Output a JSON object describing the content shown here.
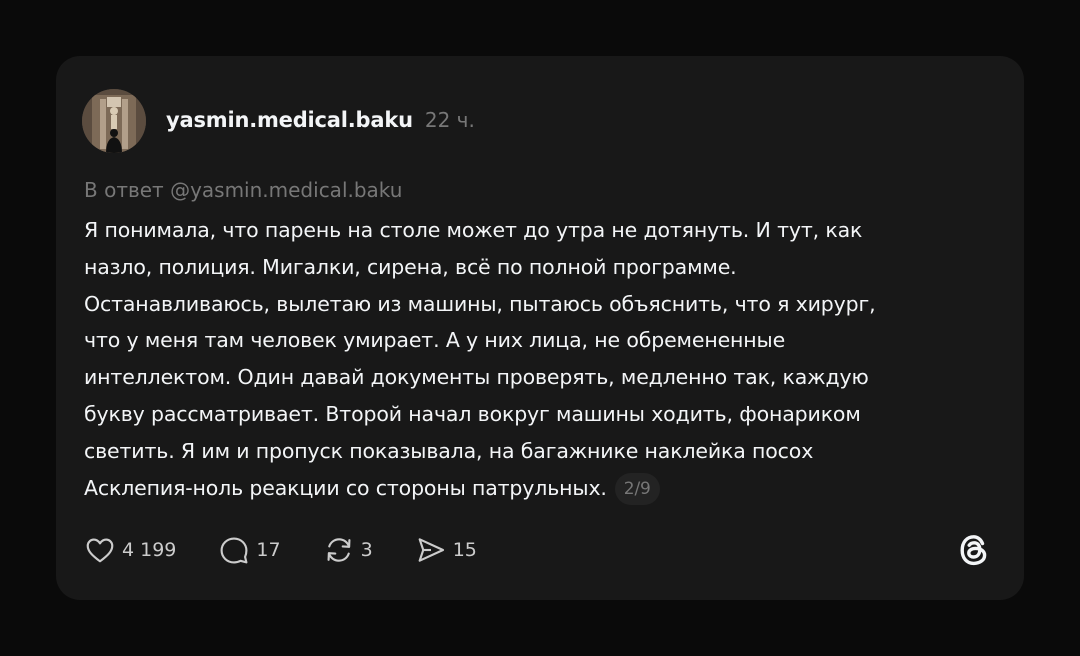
{
  "post": {
    "username": "yasmin.medical.baku",
    "time": "22 ч.",
    "reply_to": "В ответ @yasmin.medical.baku",
    "lines": [
      "Я понимала, что парень на столе может до утра не дотянуть. И тут, как",
      "назло, полиция. Мигалки, сирена, всё по полной программе.",
      "Останавливаюсь, вылетаю из машины, пытаюсь объяснить, что я хирург,",
      "что у меня там человек умирает. А у них лица, не обремененные",
      "интеллектом. Один давай документы проверять, медленно так, каждую",
      "букву рассматривает. Второй начал вокруг машины ходить, фонариком",
      "светить. Я им и пропуск показывала, на багажнике наклейка посох",
      "Асклепия-ноль реакции со стороны патрульных."
    ],
    "page_indicator": "2/9"
  },
  "actions": {
    "likes": "4 199",
    "comments": "17",
    "reposts": "3",
    "shares": "15"
  },
  "icons": {
    "like": "heart-icon",
    "comment": "comment-icon",
    "repost": "repost-icon",
    "share": "send-icon",
    "brand": "threads-logo-icon"
  },
  "colors": {
    "background": "#0a0a0a",
    "card": "#181818",
    "primary_text": "#f3f5f7",
    "secondary_text": "#777777"
  }
}
